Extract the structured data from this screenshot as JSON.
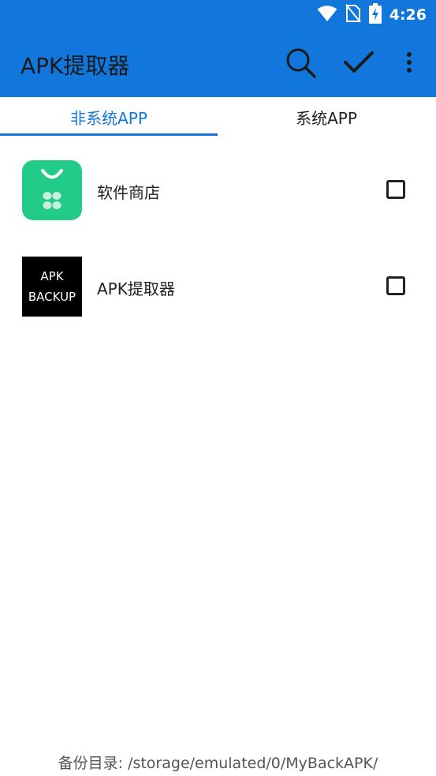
{
  "status_bar": {
    "time": "4:26",
    "icons": [
      "wifi-icon",
      "no-sim-icon",
      "battery-charging-icon"
    ]
  },
  "app_bar": {
    "title": "APK提取器",
    "actions": [
      "search-icon",
      "check-icon",
      "more-vert-icon"
    ]
  },
  "tabs": [
    {
      "label": "非系统APP",
      "selected": true
    },
    {
      "label": "系统APP",
      "selected": false
    }
  ],
  "apps": [
    {
      "name": "软件商店",
      "icon": "app-store-icon",
      "checked": false
    },
    {
      "name": "APK提取器",
      "icon": "apk-backup-icon",
      "icon_text_line1": "APK",
      "icon_text_line2": "BACKUP",
      "checked": false
    }
  ],
  "footer": {
    "backup_dir_label": "备份目录: /storage/emulated/0/MyBackAPK/"
  },
  "colors": {
    "primary": "#1177dd",
    "store_icon_green": "#22cc88"
  }
}
